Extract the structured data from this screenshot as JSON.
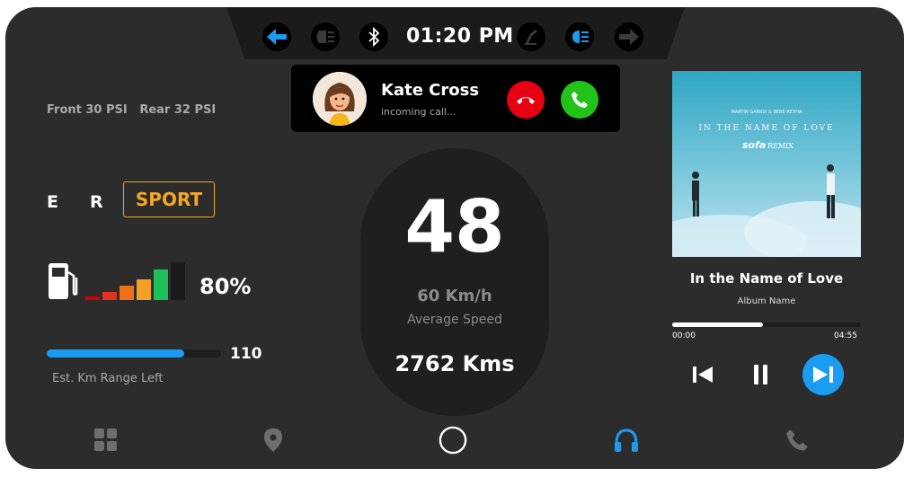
{
  "header": {
    "time": "01:20 PM",
    "icons": [
      "arrow-left-icon",
      "fog-light-icon",
      "bluetooth-icon",
      "seatbelt-icon",
      "headlight-icon",
      "arrow-right-icon"
    ]
  },
  "call": {
    "caller_name": "Kate Cross",
    "status": "incoming call...",
    "decline_color": "#e60012",
    "accept_color": "#22c318"
  },
  "tires": {
    "front": "Front 30 PSI",
    "rear": "Rear 32 PSI"
  },
  "gears": {
    "eco": "E",
    "reverse": "R",
    "sport": "SPORT"
  },
  "fuel": {
    "percent_label": "80%",
    "level": 0.8
  },
  "range": {
    "value": "110",
    "label": "Est. Km Range Left",
    "fill_fraction": 0.79
  },
  "speed": {
    "current": "48",
    "average": "60 Km/h",
    "average_label": "Average Speed",
    "odometer": "2762 Kms"
  },
  "media": {
    "album_art_text": {
      "artists": "MARTIN GARRIX & BEBE REXHA",
      "title": "IN THE NAME OF LOVE",
      "remix_brand": "sofa",
      "remix": "REMIX"
    },
    "song": "In the Name of Love",
    "album": "Album Name",
    "elapsed": "00:00",
    "duration": "04:55",
    "progress": 0.48
  },
  "nav": {
    "active": "music-nav-icon"
  },
  "colors": {
    "accent": "#1a9cf0",
    "sport": "#f5a623",
    "background": "#2c2c2c"
  }
}
